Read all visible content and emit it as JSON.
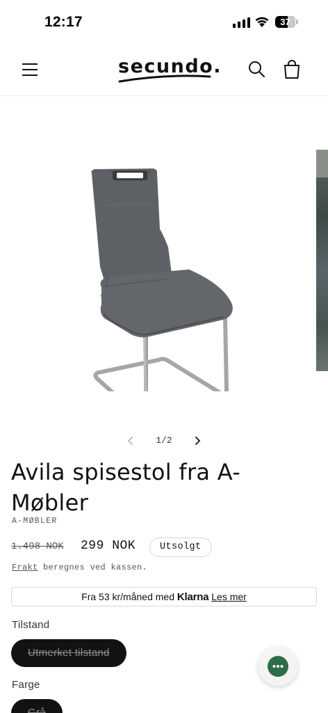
{
  "status_bar": {
    "time": "12:17",
    "battery": "37"
  },
  "header": {
    "logo_text": "secundo.",
    "icons": [
      "menu-icon",
      "search-icon",
      "cart-icon"
    ]
  },
  "gallery": {
    "counter": "1/2"
  },
  "product": {
    "title": "Avila spisestol fra A-Møbler",
    "vendor": "A-MØBLER",
    "price_old": "1.498 NOK",
    "price_new": "299 NOK",
    "badge": "Utsolgt",
    "shipping_link": "Frakt",
    "shipping_text": " beregnes ved kassen.",
    "klarna_prefix": "Fra 53 kr/måned med ",
    "klarna_brand": "Klarna",
    "klarna_link": "Les mer",
    "condition_label": "Tilstand",
    "condition_value": "Utmerket tilstand",
    "color_label": "Farge",
    "color_value": "Grå"
  },
  "colors": {
    "accent": "#121212",
    "chat": "#2e6d48",
    "chair": "#5b5e62"
  }
}
